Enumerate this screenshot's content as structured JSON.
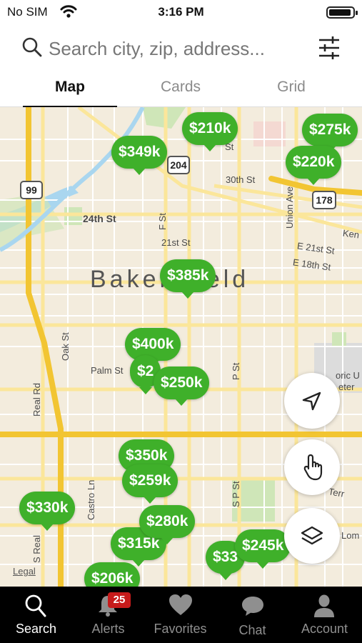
{
  "status": {
    "carrier": "No SIM",
    "time": "3:16 PM",
    "battery_level": 0.95
  },
  "search": {
    "placeholder": "Search city, zip, address...",
    "value": ""
  },
  "tabs": [
    {
      "label": "Map",
      "active": true
    },
    {
      "label": "Cards",
      "active": false
    },
    {
      "label": "Grid",
      "active": false
    }
  ],
  "map": {
    "city": "Bakersfield",
    "streets": {
      "s30th": "30th St",
      "s24th": "24th St",
      "s21st": "21st St",
      "e21st": "E 21st St",
      "e18th": "E 18th St",
      "ken": "Ken",
      "palm": "Palm St",
      "f": "F St",
      "oak": "Oak St",
      "real": "Real Rd",
      "sreal": "S Real",
      "castro": "Castro Ln",
      "union": "Union Ave",
      "p": "P St",
      "sp": "S P St",
      "st": "St",
      "terr": "Terr",
      "lom": "Lom",
      "historic": "oric U",
      "cemetery": "eter"
    },
    "highways": {
      "h99": "99",
      "h204": "204",
      "h178": "178"
    },
    "legal": "Legal",
    "pins": [
      "$349k",
      "$210k",
      "$275k",
      "$220k",
      "$385k",
      "$400k",
      "$2",
      "$250k",
      "$350k",
      "$259k",
      "$330k",
      "$280k",
      "$315k",
      "$206k",
      "$33",
      "$245k"
    ],
    "pin_color": "#3fb02a"
  },
  "nav": {
    "items": [
      {
        "label": "Search",
        "icon": "search-icon",
        "active": true
      },
      {
        "label": "Alerts",
        "icon": "bell-icon",
        "badge": "25"
      },
      {
        "label": "Favorites",
        "icon": "heart-icon"
      },
      {
        "label": "Chat",
        "icon": "chat-bubble-icon"
      },
      {
        "label": "Account",
        "icon": "person-icon"
      }
    ]
  }
}
